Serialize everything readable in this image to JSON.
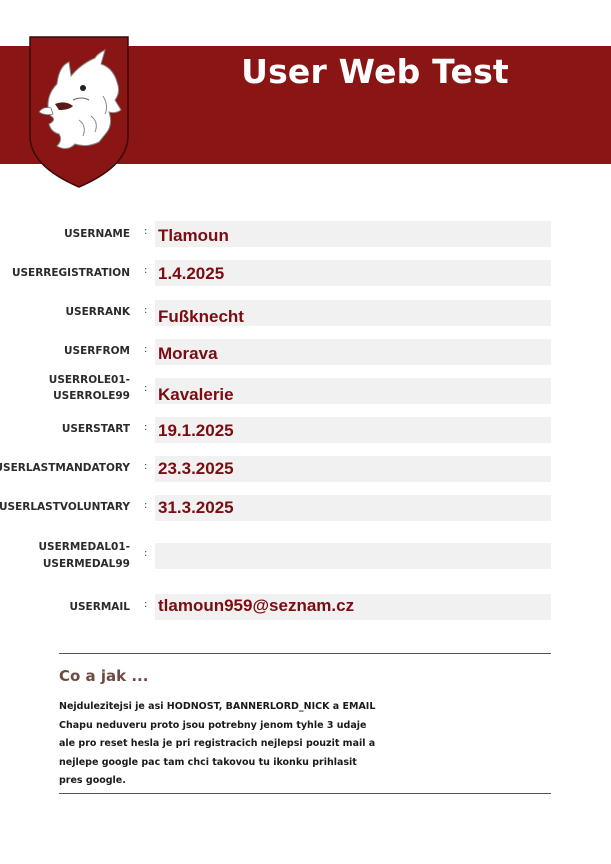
{
  "header": {
    "title": "User Web Test",
    "background_color": "#8a1515",
    "emblem": "wolf-head-shield-icon"
  },
  "form": {
    "separator": ":",
    "fields": [
      {
        "label": "USERNAME",
        "value": "Tlamoun"
      },
      {
        "label": "USERREGISTRATION",
        "value": "1.4.2025"
      },
      {
        "label": "USERRANK",
        "value": "Fußknecht"
      },
      {
        "label": "USERFROM",
        "value": "Morava"
      },
      {
        "label_line1": "USERROLE01-",
        "label_line2": "USERROLE99",
        "value": "Kavalerie"
      },
      {
        "label": "USERSTART",
        "value": "19.1.2025"
      },
      {
        "label": "USERLASTMANDATORY",
        "value": "23.3.2025"
      },
      {
        "label": "USERLASTVOLUNTARY",
        "value": "31.3.2025"
      },
      {
        "label_line1": "USERMEDAL01-",
        "label_line2": "USERMEDAL99",
        "value": ""
      },
      {
        "label": "USERMAIL",
        "value": "tlamoun959@seznam.cz"
      }
    ],
    "value_color": "#7a0c12"
  },
  "info": {
    "title": "Co a jak ...",
    "text": "Nejdulezitejsi je asi HODNOST, BANNERLORD_NICK a EMAIL\nChapu neduveru proto jsou potrebny jenom tyhle 3 udaje\nale pro reset hesla je pri registracich nejlepsi pouzit mail a\nnejlepe google pac tam chci takovou tu ikonku prihlasit\npres google."
  }
}
